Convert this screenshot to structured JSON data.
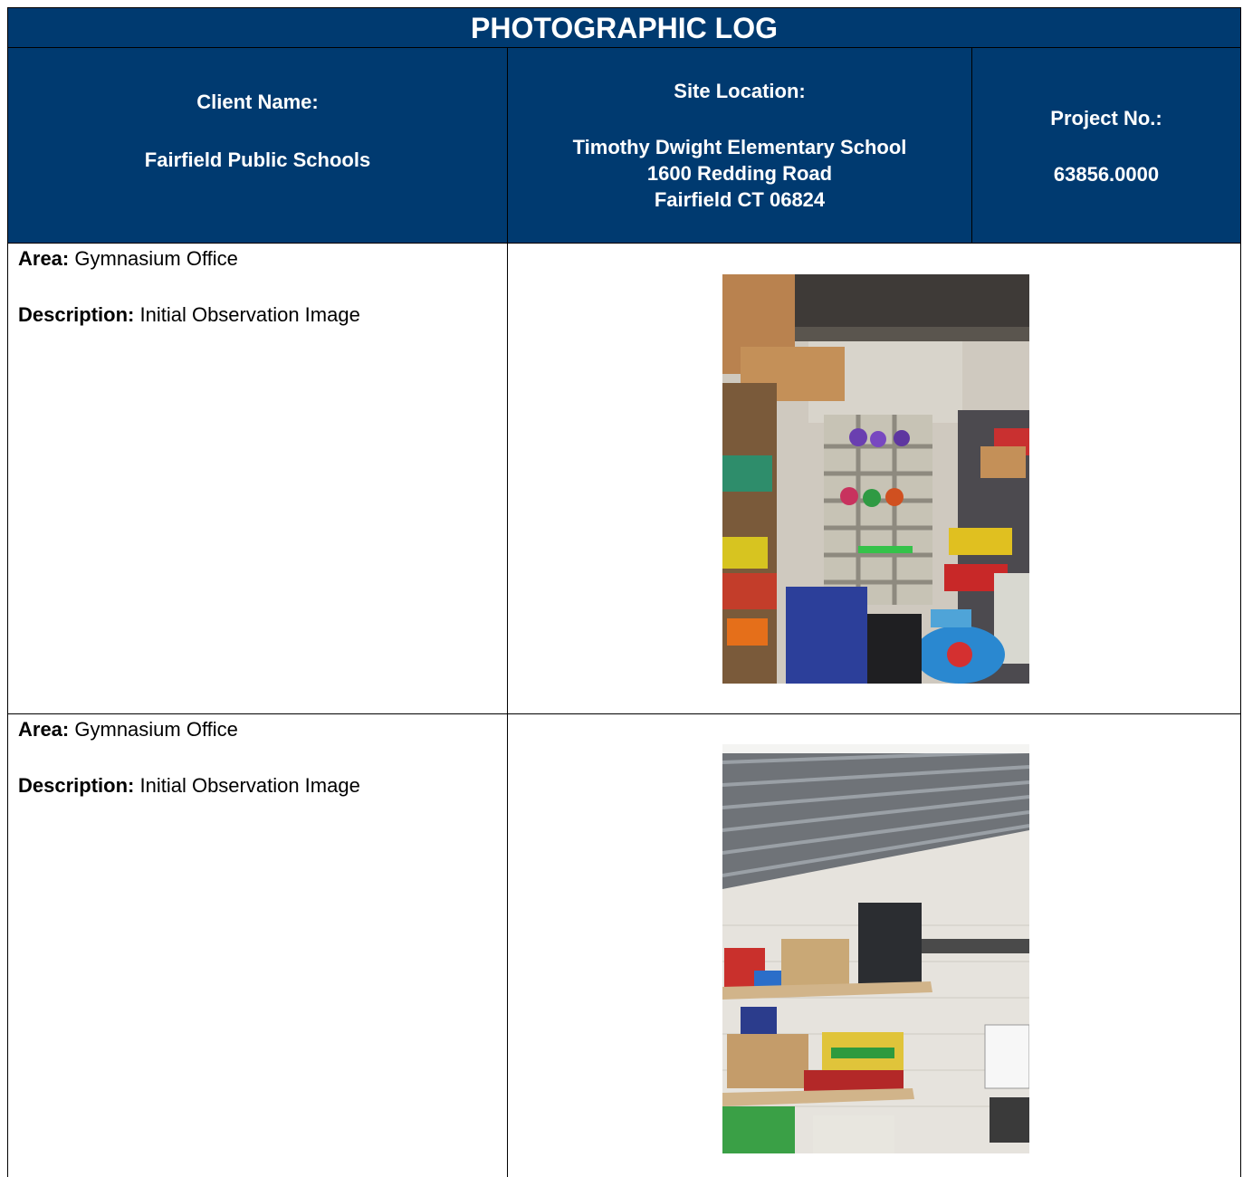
{
  "header": {
    "title": "PHOTOGRAPHIC LOG",
    "client_label": "Client Name:",
    "client_value": "Fairfield Public Schools",
    "site_label": "Site Location:",
    "site_lines": [
      "Timothy Dwight Elementary School",
      "1600 Redding Road",
      "Fairfield CT 06824"
    ],
    "project_label": "Project No.:",
    "project_value": "63856.0000"
  },
  "entries": [
    {
      "area_label": "Area:",
      "area_value": "Gymnasium Office",
      "description_label": "Description:",
      "description_value": "Initial Observation Image",
      "photo": "storage-room-shelves-photo"
    },
    {
      "area_label": "Area:",
      "area_value": "Gymnasium Office",
      "description_label": "Description:",
      "description_value": "Initial Observation Image",
      "photo": "storage-wall-shelf-photo"
    }
  ]
}
